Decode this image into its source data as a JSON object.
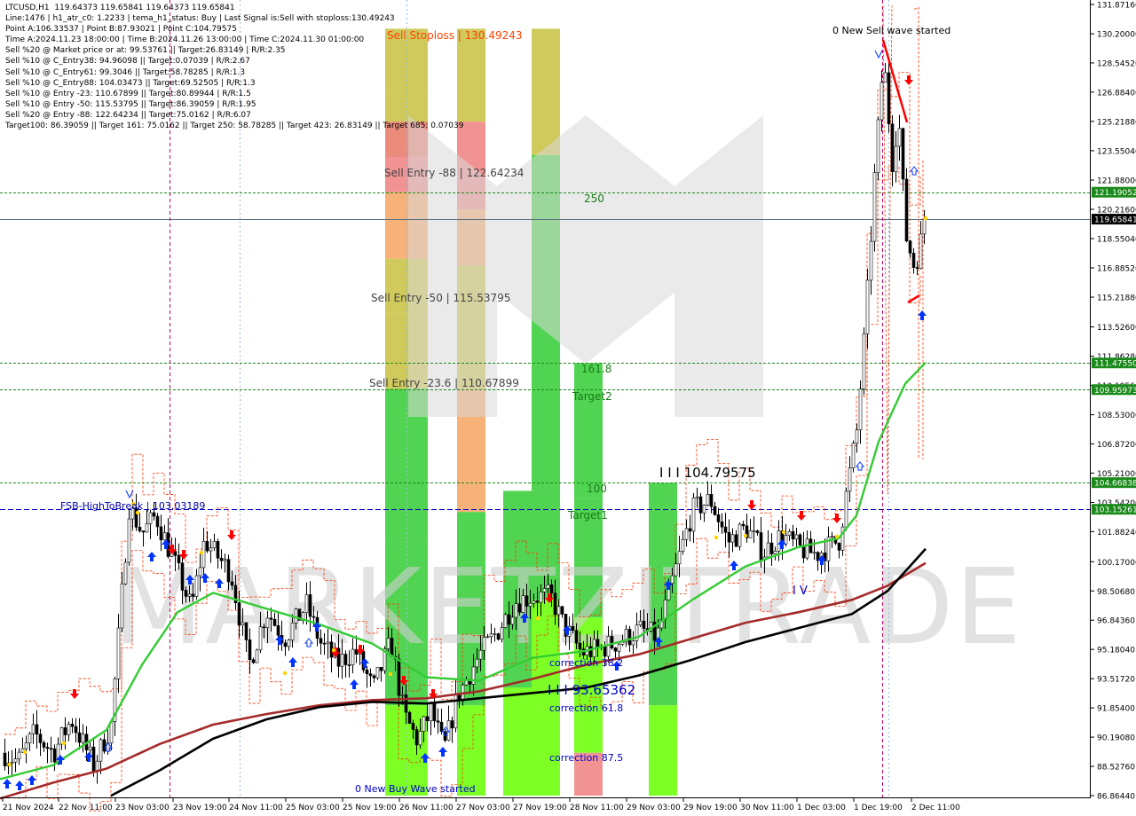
{
  "info_panel": {
    "lines": [
      "LTCUSD,H1  119.64373 119.65841 119.64373 119.65841",
      "Line:1476 | h1_atr_c0: 1.2233 | tema_h1_status: Buy | Last Signal is:Sell with stoploss:130.49243",
      "Point A:106.33537 | Point B:87.93021 | Point C:104.79575",
      "Time A:2024.11.23 18:00:00 | Time B:2024.11.26 13:00:00 | Time C:2024.11.30 01:00:00",
      "Sell %20 @ Market price or at: 99.53761 || Target:26.83149 | R/R:2.35",
      "Sell %10 @ C_Entry38: 94.96098 || Target:0.07039 | R/R:2.67",
      "Sell %10 @ C_Entry61: 99.3046 || Target:58.78285 | R/R:1.3",
      "Sell %10 @ C_Entry88: 104.03473 || Target:69.52505 | R/R:1.3",
      "Sell %10 @ Entry -23: 110.67899 || Target:80.89944 | R/R:1.5",
      "Sell %10 @ Entry -50: 115.53795 || Target:86.39059 | R/R:1.95",
      "Sell %20 @ Entry -88: 122.64234 || Target:75.0162 | R/R:6.07",
      "Target100: 86.39059 || Target 161: 75.0162 || Target 250: 58.78285 || Target 423: 26.83149 || Target 685: 0.07039"
    ]
  },
  "watermark": "MARKETZITRADE",
  "colors": {
    "background": "#ffffff",
    "candle": "#000000",
    "ema_green": "#33cc33",
    "ma_black": "#000000",
    "ma_darkred": "#a52a2a",
    "envelope": "#ff3300",
    "hline_green": "#1a8a1a",
    "hline_blue": "#0000cc",
    "price_current": "#5a7080",
    "buy_arrow": "#0033ff",
    "sell_arrow": "#ff0000",
    "zone_red": "#f08080",
    "zone_orange": "#f4a460",
    "zone_olive": "#c8c040",
    "zone_green": "#33cc33",
    "zone_lime": "#66ff00"
  },
  "chart_data": {
    "type": "candlestick",
    "symbol": "LTCUSD,H1",
    "ylim": [
      86.8644,
      131.8716
    ],
    "x_labels": [
      "21 Nov 2024",
      "22 Nov 11:00",
      "23 Nov 03:00",
      "23 Nov 19:00",
      "24 Nov 11:00",
      "25 Nov 03:00",
      "25 Nov 19:00",
      "26 Nov 11:00",
      "27 Nov 03:00",
      "27 Nov 19:00",
      "28 Nov 11:00",
      "29 Nov 03:00",
      "29 Nov 19:00",
      "30 Nov 11:00",
      "1 Dec 03:00",
      "1 Dec 19:00",
      "2 Dec 11:00"
    ],
    "y_ticks": [
      "131.87160",
      "130.20000",
      "128.54520",
      "126.88400",
      "125.21880",
      "123.55040",
      "121.88000",
      "120.21600",
      "118.55040",
      "116.88520",
      "115.21880",
      "113.52600",
      "111.86280",
      "110.19560",
      "108.53000",
      "106.87200",
      "105.21000",
      "103.54200",
      "101.88240",
      "100.17000",
      "98.50680",
      "96.84360",
      "95.18040",
      "93.51720",
      "91.85400",
      "90.19080",
      "88.52760",
      "86.86440"
    ],
    "price_boxes": [
      {
        "value": 121.19052,
        "label": "121.19052",
        "color": "#1a8a1a",
        "line": "green-dotted"
      },
      {
        "value": 119.65841,
        "label": "119.65841",
        "color": "#000000",
        "line": "current"
      },
      {
        "value": 111.4755,
        "label": "111.47550",
        "color": "#1a8a1a",
        "line": "green-dotted"
      },
      {
        "value": 109.95973,
        "label": "109.95973",
        "color": "#1a8a1a",
        "line": "green-dotted"
      },
      {
        "value": 104.66838,
        "label": "104.66838",
        "color": "#1a8a1a",
        "line": "green-dotted"
      },
      {
        "value": 103.15261,
        "label": "103.15261",
        "color": "#1a8a1a",
        "line": "blue-dashed"
      }
    ],
    "annotations": {
      "sell_stoploss": "Sell Stoploss | 130.49243",
      "sell_entry_88": "Sell Entry -88 | 122.64234",
      "sell_entry_50": "Sell Entry -50 | 115.53795",
      "sell_entry_23": "Sell Entry -23.6 | 110.67899",
      "level_250": "250",
      "level_161": "161.8",
      "target2": "Target2",
      "level_100": "100",
      "target1": "Target1",
      "point_c": "I I I 104.79575",
      "point_b": "I I I 93.65362",
      "fsb": "FSB-HighToBreak | 103.03189",
      "corr_382": "correction 38.2",
      "corr_618": "correction 61.8",
      "corr_875": "correction 87.5",
      "new_buy_wave": "0 New Buy Wave started",
      "new_sell_wave": "0 New Sell wave started",
      "iv": "I V"
    },
    "series": [
      {
        "name": "price",
        "anchors": [
          [
            0,
            89.4
          ],
          [
            20,
            88.8
          ],
          [
            38,
            90.4
          ],
          [
            60,
            89.3
          ],
          [
            80,
            91.2
          ],
          [
            105,
            88.6
          ],
          [
            125,
            90.9
          ],
          [
            145,
            103.3
          ],
          [
            160,
            101.8
          ],
          [
            175,
            102.8
          ],
          [
            200,
            99.6
          ],
          [
            215,
            97.5
          ],
          [
            230,
            101.4
          ],
          [
            260,
            99.5
          ],
          [
            280,
            94.3
          ],
          [
            300,
            97.4
          ],
          [
            320,
            95.8
          ],
          [
            345,
            97.7
          ],
          [
            360,
            95.6
          ],
          [
            380,
            94.4
          ],
          [
            400,
            95.1
          ],
          [
            420,
            92.9
          ],
          [
            440,
            95.6
          ],
          [
            455,
            91.4
          ],
          [
            470,
            90.0
          ],
          [
            485,
            91.7
          ],
          [
            500,
            89.5
          ],
          [
            515,
            92.5
          ],
          [
            540,
            94.9
          ],
          [
            560,
            96.2
          ],
          [
            580,
            97.9
          ],
          [
            600,
            98.2
          ],
          [
            620,
            98.2
          ],
          [
            635,
            96.5
          ],
          [
            655,
            95.0
          ],
          [
            675,
            95.2
          ],
          [
            700,
            95.7
          ],
          [
            720,
            96.3
          ],
          [
            740,
            95.9
          ],
          [
            760,
            99.6
          ],
          [
            780,
            103.1
          ],
          [
            800,
            103.7
          ],
          [
            820,
            101.3
          ],
          [
            840,
            102.1
          ],
          [
            860,
            100.7
          ],
          [
            880,
            101.7
          ],
          [
            900,
            100.9
          ],
          [
            920,
            100.6
          ],
          [
            945,
            101.4
          ],
          [
            955,
            104.6
          ],
          [
            965,
            107.6
          ],
          [
            975,
            113.9
          ],
          [
            985,
            122.0
          ],
          [
            995,
            128.9
          ],
          [
            1005,
            123.0
          ],
          [
            1012,
            125.6
          ],
          [
            1020,
            118.8
          ],
          [
            1030,
            116.9
          ],
          [
            1043,
            119.66
          ]
        ]
      },
      {
        "name": "ema_green",
        "anchors": [
          [
            0,
            87.8
          ],
          [
            60,
            88.6
          ],
          [
            120,
            90.6
          ],
          [
            160,
            94.3
          ],
          [
            200,
            97.3
          ],
          [
            240,
            98.4
          ],
          [
            300,
            97.5
          ],
          [
            360,
            96.6
          ],
          [
            420,
            95.5
          ],
          [
            480,
            93.6
          ],
          [
            540,
            93.4
          ],
          [
            600,
            94.7
          ],
          [
            660,
            95.1
          ],
          [
            720,
            95.9
          ],
          [
            780,
            98.0
          ],
          [
            840,
            99.9
          ],
          [
            900,
            101.0
          ],
          [
            945,
            101.5
          ],
          [
            965,
            102.8
          ],
          [
            990,
            107.0
          ],
          [
            1020,
            110.3
          ],
          [
            1043,
            111.5
          ]
        ]
      },
      {
        "name": "ma_black",
        "anchors": [
          [
            125,
            86.86
          ],
          [
            180,
            88.3
          ],
          [
            240,
            90.1
          ],
          [
            300,
            91.2
          ],
          [
            360,
            91.9
          ],
          [
            420,
            92.2
          ],
          [
            480,
            92.1
          ],
          [
            540,
            92.4
          ],
          [
            600,
            92.7
          ],
          [
            660,
            93.0
          ],
          [
            720,
            93.7
          ],
          [
            780,
            94.6
          ],
          [
            840,
            95.6
          ],
          [
            900,
            96.4
          ],
          [
            960,
            97.2
          ],
          [
            1000,
            98.5
          ],
          [
            1043,
            100.9
          ]
        ]
      },
      {
        "name": "ma_darkred",
        "anchors": [
          [
            0,
            86.7
          ],
          [
            60,
            87.6
          ],
          [
            120,
            88.4
          ],
          [
            180,
            89.8
          ],
          [
            240,
            90.9
          ],
          [
            300,
            91.5
          ],
          [
            360,
            92.0
          ],
          [
            420,
            92.3
          ],
          [
            480,
            92.4
          ],
          [
            540,
            92.8
          ],
          [
            600,
            93.5
          ],
          [
            660,
            94.3
          ],
          [
            720,
            94.9
          ],
          [
            780,
            95.8
          ],
          [
            840,
            96.7
          ],
          [
            900,
            97.3
          ],
          [
            960,
            98.0
          ],
          [
            1000,
            98.8
          ],
          [
            1043,
            100.1
          ]
        ]
      }
    ],
    "vertical_lines": [
      {
        "x_label": "22 Nov 2024 (A)",
        "style": "magenta-dashed"
      },
      {
        "x_label": "23 Nov 03:00",
        "style": "magenta-dashed"
      },
      {
        "x_label": "1 Dec 19:00",
        "style": "magenta-dashed"
      }
    ],
    "zones": [
      {
        "col": 0,
        "bands": [
          [
            130.49,
            127.0,
            "olive"
          ],
          [
            127.0,
            123.2,
            "olive"
          ],
          [
            125.2,
            121.2,
            "red"
          ],
          [
            121.2,
            117.4,
            "orange"
          ],
          [
            117.4,
            114.3,
            "olive"
          ],
          [
            114.3,
            110.0,
            "olive"
          ],
          [
            110.0,
            101.5,
            "green"
          ],
          [
            101.5,
            92.0,
            "green"
          ],
          [
            92.0,
            86.86,
            "lime"
          ]
        ]
      },
      {
        "col": 1,
        "bands": [
          [
            130.49,
            125.2,
            "olive"
          ],
          [
            125.2,
            120.2,
            "red"
          ],
          [
            120.2,
            117.0,
            "orange"
          ],
          [
            117.0,
            110.0,
            "olive"
          ],
          [
            110.0,
            103.0,
            "orange"
          ],
          [
            103.0,
            98.0,
            "green"
          ],
          [
            98.0,
            92.0,
            "green"
          ],
          [
            92.0,
            86.86,
            "lime"
          ]
        ]
      },
      {
        "col": 2,
        "bands": [
          [
            104.2,
            99.0,
            "green"
          ],
          [
            99.0,
            93.0,
            "green"
          ],
          [
            93.0,
            86.86,
            "lime"
          ]
        ]
      },
      {
        "col": 3,
        "bands": [
          [
            130.49,
            123.3,
            "olive"
          ],
          [
            123.3,
            104.2,
            "green"
          ],
          [
            104.2,
            98.0,
            "green"
          ],
          [
            98.0,
            86.86,
            "lime"
          ]
        ]
      },
      {
        "col": 4,
        "bands": [
          [
            111.47,
            103.8,
            "green"
          ],
          [
            103.8,
            97.0,
            "green"
          ],
          [
            97.0,
            89.3,
            "lime"
          ],
          [
            89.3,
            86.86,
            "red"
          ]
        ]
      },
      {
        "col": 5,
        "bands": [
          [
            104.66,
            98.3,
            "green"
          ],
          [
            98.3,
            92.0,
            "green"
          ],
          [
            92.0,
            86.86,
            "lime"
          ]
        ]
      }
    ]
  }
}
